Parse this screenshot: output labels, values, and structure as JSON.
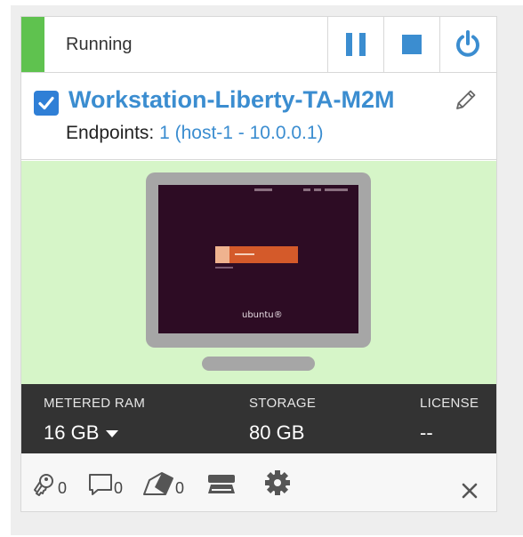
{
  "status": {
    "text": "Running",
    "color": "#5fc24f",
    "controls": [
      "pause-icon",
      "stop-icon",
      "power-icon"
    ]
  },
  "vm": {
    "name": "Workstation-Liberty-TA-M2M",
    "selected": true,
    "endpoints_label": "Endpoints:",
    "endpoints_value": "1 (host-1 - 10.0.0.1)"
  },
  "preview": {
    "os_logo_text": "ubuntu®"
  },
  "stats": {
    "ram_label": "METERED RAM",
    "ram_value": "16 GB",
    "storage_label": "STORAGE",
    "storage_value": "80 GB",
    "license_label": "LICENSE",
    "license_value": "--"
  },
  "footer": {
    "keys_count": "0",
    "comments_count": "0",
    "tags_count": "0"
  },
  "colors": {
    "accent": "#3b8dd0",
    "preview_bg": "#d6f5c8",
    "stats_bg": "#333333"
  }
}
